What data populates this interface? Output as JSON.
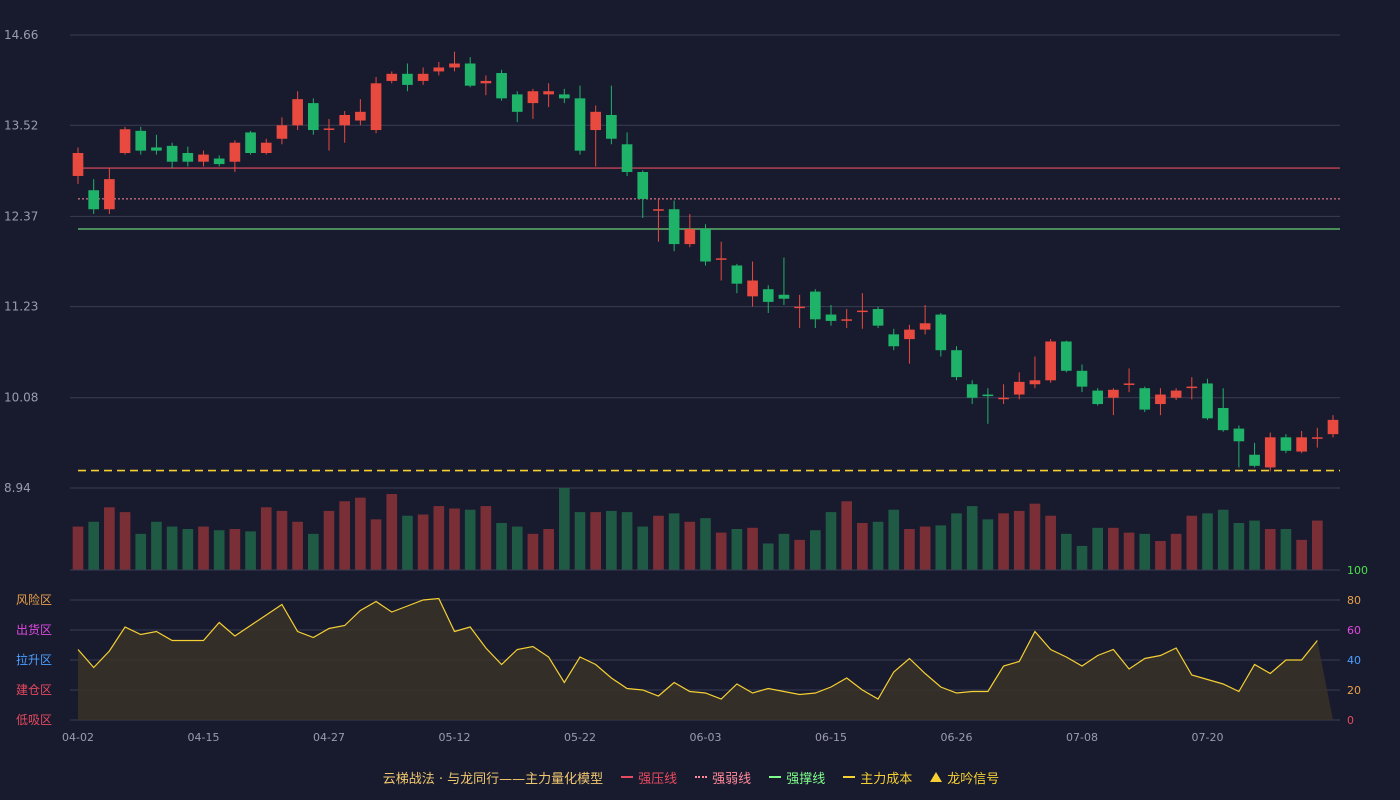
{
  "colors": {
    "background": "#181a2e",
    "grid": "#3a3d52",
    "axis_text": "#9a9cae",
    "up": "#e84a3f",
    "down": "#1fb36a",
    "up_volume": "#7a2f36",
    "down_volume": "#1f5a44",
    "resistance": "#e84a5f",
    "weak": "#ff8a9a",
    "support": "#7dff8a",
    "cost": "#f5d033",
    "oscillator_line": "#f5d033",
    "oscillator_fill": "#3a3228"
  },
  "legend": {
    "title": "云梯战法 · 与龙同行——主力量化模型",
    "items": [
      {
        "label": "强压线",
        "color": "#e84a5f",
        "style": "solid"
      },
      {
        "label": "强弱线",
        "color": "#ff8a9a",
        "style": "dotted"
      },
      {
        "label": "强撑线",
        "color": "#7dff8a",
        "style": "solid"
      },
      {
        "label": "主力成本",
        "color": "#f5d033",
        "style": "dashed"
      },
      {
        "label": "龙吟信号",
        "color": "#f5d033",
        "style": "triangle",
        "icon": "triangle-up-icon"
      }
    ]
  },
  "chart_data": {
    "type": "candlestick",
    "x_ticks": [
      "04-02",
      "04-15",
      "04-27",
      "05-12",
      "05-22",
      "06-03",
      "06-15",
      "06-26",
      "07-08",
      "07-20"
    ],
    "x_tick_indices": [
      0,
      8,
      16,
      24,
      32,
      40,
      48,
      56,
      64,
      72
    ],
    "price_ticks": [
      "14.66",
      "13.52",
      "12.37",
      "11.23",
      "10.08",
      "8.94"
    ],
    "ylim": [
      8.94,
      14.66
    ],
    "lines": {
      "strong_pressure": 12.98,
      "weak_strong": 12.59,
      "strong_support": 12.21,
      "main_cost": 9.16
    },
    "candles": [
      [
        12.88,
        13.17,
        12.78,
        13.24
      ],
      [
        12.7,
        12.46,
        12.4,
        12.84
      ],
      [
        12.46,
        12.84,
        12.4,
        12.98
      ],
      [
        13.17,
        13.47,
        13.15,
        13.5
      ],
      [
        13.45,
        13.2,
        13.15,
        13.5
      ],
      [
        13.24,
        13.2,
        13.15,
        13.4
      ],
      [
        13.26,
        13.06,
        12.98,
        13.3
      ],
      [
        13.17,
        13.06,
        13.0,
        13.25
      ],
      [
        13.06,
        13.15,
        13.0,
        13.2
      ],
      [
        13.1,
        13.03,
        13.0,
        13.14
      ],
      [
        13.06,
        13.3,
        12.93,
        13.33
      ],
      [
        13.43,
        13.17,
        13.15,
        13.45
      ],
      [
        13.17,
        13.3,
        13.15,
        13.35
      ],
      [
        13.35,
        13.52,
        13.28,
        13.62
      ],
      [
        13.52,
        13.85,
        13.46,
        13.95
      ],
      [
        13.8,
        13.46,
        13.4,
        13.86
      ],
      [
        13.48,
        13.48,
        13.2,
        13.6
      ],
      [
        13.52,
        13.65,
        13.3,
        13.7
      ],
      [
        13.58,
        13.69,
        13.52,
        13.85
      ],
      [
        13.46,
        14.05,
        13.42,
        14.13
      ],
      [
        14.08,
        14.17,
        14.05,
        14.2
      ],
      [
        14.17,
        14.03,
        13.95,
        14.3
      ],
      [
        14.08,
        14.17,
        14.03,
        14.25
      ],
      [
        14.2,
        14.25,
        14.15,
        14.32
      ],
      [
        14.25,
        14.3,
        14.2,
        14.45
      ],
      [
        14.3,
        14.02,
        14.0,
        14.38
      ],
      [
        14.05,
        14.08,
        13.9,
        14.15
      ],
      [
        14.18,
        13.86,
        13.83,
        14.22
      ],
      [
        13.91,
        13.69,
        13.56,
        13.95
      ],
      [
        13.8,
        13.95,
        13.6,
        13.98
      ],
      [
        13.91,
        13.95,
        13.75,
        14.05
      ],
      [
        13.91,
        13.86,
        13.8,
        13.98
      ],
      [
        13.86,
        13.2,
        13.15,
        14.02
      ],
      [
        13.46,
        13.69,
        13.0,
        13.77
      ],
      [
        13.65,
        13.35,
        13.28,
        14.02
      ],
      [
        13.28,
        12.93,
        12.88,
        13.43
      ],
      [
        12.93,
        12.59,
        12.35,
        12.95
      ],
      [
        12.46,
        12.46,
        12.05,
        12.59
      ],
      [
        12.46,
        12.02,
        11.93,
        12.57
      ],
      [
        12.02,
        12.21,
        11.98,
        12.4
      ],
      [
        12.21,
        11.8,
        11.75,
        12.27
      ],
      [
        11.84,
        11.84,
        11.56,
        12.05
      ],
      [
        11.75,
        11.52,
        11.4,
        11.77
      ],
      [
        11.36,
        11.56,
        11.23,
        11.8
      ],
      [
        11.45,
        11.29,
        11.15,
        11.5
      ],
      [
        11.38,
        11.33,
        11.25,
        11.85
      ],
      [
        11.23,
        11.23,
        10.96,
        11.38
      ],
      [
        11.42,
        11.07,
        10.96,
        11.45
      ],
      [
        11.13,
        11.05,
        10.99,
        11.25
      ],
      [
        11.07,
        11.07,
        10.96,
        11.2
      ],
      [
        11.18,
        11.18,
        10.95,
        11.4
      ],
      [
        11.2,
        10.99,
        10.96,
        11.23
      ],
      [
        10.88,
        10.73,
        10.68,
        10.95
      ],
      [
        10.82,
        10.94,
        10.51,
        11.0
      ],
      [
        10.94,
        11.02,
        10.88,
        11.25
      ],
      [
        11.13,
        10.68,
        10.6,
        11.15
      ],
      [
        10.68,
        10.34,
        10.3,
        10.73
      ],
      [
        10.25,
        10.08,
        10.0,
        10.3
      ],
      [
        10.12,
        10.1,
        9.75,
        10.2
      ],
      [
        10.08,
        10.08,
        10.0,
        10.25
      ],
      [
        10.12,
        10.28,
        10.06,
        10.4
      ],
      [
        10.25,
        10.3,
        10.2,
        10.6
      ],
      [
        10.3,
        10.79,
        10.27,
        10.82
      ],
      [
        10.79,
        10.42,
        10.4,
        10.8
      ],
      [
        10.42,
        10.22,
        10.15,
        10.5
      ],
      [
        10.17,
        10.0,
        9.98,
        10.2
      ],
      [
        10.08,
        10.18,
        9.86,
        10.2
      ],
      [
        10.26,
        10.26,
        10.15,
        10.45
      ],
      [
        10.2,
        9.93,
        9.9,
        10.22
      ],
      [
        10.0,
        10.12,
        9.86,
        10.2
      ],
      [
        10.08,
        10.17,
        10.05,
        10.2
      ],
      [
        10.22,
        10.22,
        10.06,
        10.34
      ],
      [
        10.26,
        9.82,
        9.8,
        10.32
      ],
      [
        9.95,
        9.67,
        9.65,
        10.2
      ],
      [
        9.69,
        9.53,
        9.2,
        9.73
      ],
      [
        9.36,
        9.22,
        9.2,
        9.51
      ],
      [
        9.2,
        9.58,
        9.15,
        9.64
      ],
      [
        9.58,
        9.41,
        9.38,
        9.62
      ],
      [
        9.4,
        9.58,
        9.38,
        9.66
      ],
      [
        9.58,
        9.58,
        9.45,
        9.7
      ],
      [
        9.62,
        9.8,
        9.58,
        9.86
      ]
    ],
    "volume": [
      36,
      40,
      52,
      48,
      30,
      40,
      36,
      34,
      36,
      33,
      34,
      32,
      52,
      49,
      40,
      30,
      49,
      57,
      60,
      42,
      63,
      45,
      46,
      53,
      51,
      50,
      53,
      39,
      36,
      30,
      34,
      68,
      48,
      48,
      49,
      48,
      36,
      45,
      47,
      40,
      43,
      31,
      34,
      35,
      22,
      30,
      25,
      33,
      48,
      57,
      39,
      40,
      50,
      34,
      36,
      37,
      47,
      53,
      42,
      47,
      49,
      55,
      45,
      30,
      20,
      35,
      35,
      31,
      30,
      24,
      30,
      45,
      47,
      50,
      39,
      41,
      34,
      34,
      25,
      41
    ],
    "oscillator": {
      "values": [
        47,
        35,
        46,
        62,
        57,
        59,
        53,
        53,
        53,
        65,
        56,
        63,
        70,
        77,
        59,
        55,
        61,
        63,
        73,
        79,
        72,
        76,
        80,
        81,
        59,
        62,
        48,
        37,
        47,
        49,
        42,
        25,
        42,
        37,
        28,
        21,
        20,
        16,
        25,
        19,
        18,
        14,
        24,
        18,
        21,
        19,
        17,
        18,
        22,
        28,
        20,
        14,
        32,
        41,
        31,
        22,
        18,
        19,
        19,
        36,
        39,
        59,
        47,
        42,
        36,
        43,
        47,
        34,
        41,
        43,
        48,
        30,
        27,
        24,
        19,
        37,
        31,
        40,
        40,
        53
      ],
      "ylim": [
        0,
        100
      ],
      "ticks": [
        "0",
        "20",
        "40",
        "60",
        "80",
        "100"
      ],
      "tick_colors": [
        "#e84a5f",
        "#e8a04a",
        "#4aa0ff",
        "#e04ae0",
        "#e8a04a",
        "#4ae04a"
      ],
      "zones": [
        "低吸区",
        "建仓区",
        "拉升区",
        "出货区",
        "风险区"
      ],
      "zone_colors": [
        "#e84a5f",
        "#e84a5f",
        "#4aa0ff",
        "#e04ae0",
        "#e8a04a"
      ]
    }
  }
}
